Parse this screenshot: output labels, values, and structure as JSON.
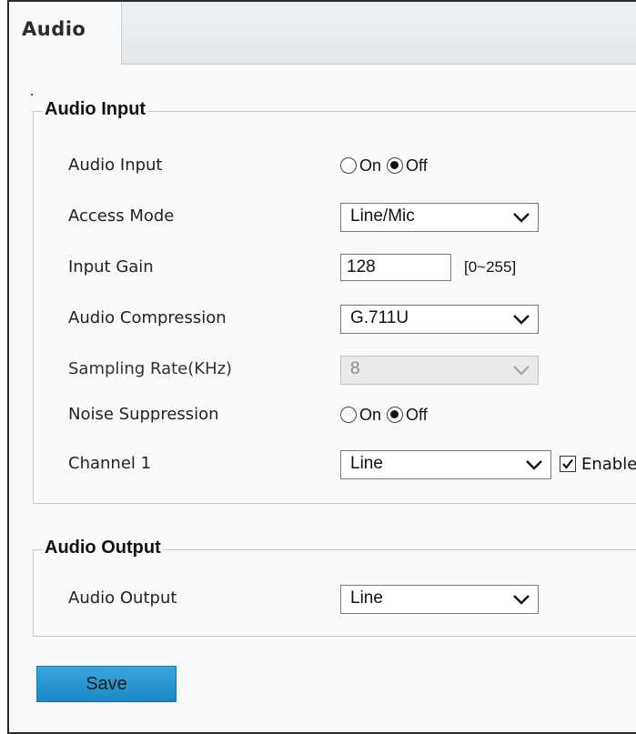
{
  "tabs": [
    {
      "label": "Audio",
      "active": true
    }
  ],
  "audio_input": {
    "legend": "Audio Input",
    "audio_input": {
      "label": "Audio Input",
      "options": [
        "On",
        "Off"
      ],
      "selected": "Off"
    },
    "access_mode": {
      "label": "Access Mode",
      "value": "Line/Mic"
    },
    "input_gain": {
      "label": "Input Gain",
      "value": "128",
      "range": "[0~255]"
    },
    "audio_compression": {
      "label": "Audio Compression",
      "value": "G.711U"
    },
    "sampling_rate": {
      "label": "Sampling Rate(KHz)",
      "value": "8",
      "disabled": true
    },
    "noise_suppression": {
      "label": "Noise Suppression",
      "options": [
        "On",
        "Off"
      ],
      "selected": "Off"
    },
    "channel_1": {
      "label": "Channel 1",
      "value": "Line",
      "enable_label": "Enable",
      "enabled": true
    }
  },
  "audio_output": {
    "legend": "Audio Output",
    "audio_output": {
      "label": "Audio Output",
      "value": "Line"
    }
  },
  "save_label": "Save",
  "colors": {
    "save_button": "#2a97d2",
    "tabbar": "#e6e9ec",
    "border": "#c8c8c8"
  }
}
